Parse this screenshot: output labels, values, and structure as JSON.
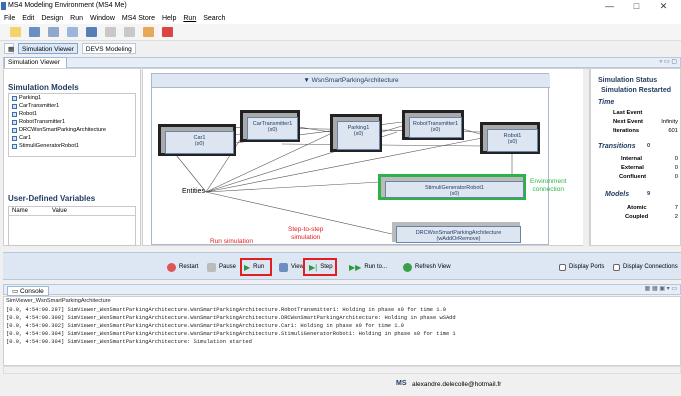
{
  "window": {
    "title": "MS4 Modeling Environment (MS4 Me)",
    "minimize": "—",
    "maximize": "□",
    "close": "✕"
  },
  "menu": [
    "File",
    "Edit",
    "Design",
    "Run",
    "Window",
    "MS4 Store",
    "Help",
    "Run",
    "Search"
  ],
  "toolbar_icons": [
    "new-icon",
    "save-icon",
    "copy-icon",
    "home-icon",
    "pen-icon",
    "nav-back-icon",
    "nav-forward-icon",
    "arrow-icon",
    "tool-icon"
  ],
  "perspective_tabs": [
    "Simulation Viewer",
    "DEVS Modeling"
  ],
  "view_tab": "Simulation Viewer",
  "sidebar": {
    "models_title": "Simulation Models",
    "models": [
      "Parking1",
      "CarTransmitter1",
      "Robot1",
      "RobotTransmitter1",
      "DRCWsnSmartParkingArchitecture",
      "Car1",
      "StimuliGeneratorRobot1"
    ],
    "vars_title": "User-Defined Variables",
    "vars_cols": [
      "Name",
      "Value"
    ]
  },
  "diagram": {
    "title": "WsnSmartParkingArchitecture",
    "blocks": {
      "car": {
        "name": "Car1",
        "phase": "(s0)"
      },
      "car_tx": {
        "name": "CarTransmitter1",
        "phase": "(s0)"
      },
      "parking": {
        "name": "Parking1",
        "phase": "(s0)"
      },
      "robot_tx": {
        "name": "RobotTransmitter1",
        "phase": "(s0)"
      },
      "robot": {
        "name": "Robot1",
        "phase": "(s0)"
      },
      "stimuli": {
        "name": "StimuliGeneratorRobot1",
        "phase": "(s0)"
      },
      "drc": {
        "name": "DRCWsnSmartParkingArchitecture",
        "phase": "(wAddOrRemove)"
      }
    },
    "annotations": {
      "entities": "Entities",
      "env1": "Environment",
      "env2": "connection",
      "run": "Run simulation",
      "step1": "Step-to-step",
      "step2": "simulation"
    }
  },
  "status": {
    "title": "Simulation Status",
    "state": "Simulation Restarted",
    "time_h": "Time",
    "last_event": "Last Event",
    "last_event_v": "",
    "next_event": "Next Event",
    "next_event_v": "Infinity",
    "iterations": "Iterations",
    "iterations_v": "601",
    "transitions_h": "Transitions",
    "transitions_v": "0",
    "internal": "Internal",
    "internal_v": "0",
    "external": "External",
    "external_v": "0",
    "confluent": "Confluent",
    "confluent_v": "0",
    "models_h": "Models",
    "models_v": "9",
    "atomic": "Atomic",
    "atomic_v": "7",
    "coupled": "Coupled",
    "coupled_v": "2"
  },
  "simbar": {
    "restart": "Restart",
    "pause": "Pause",
    "run": "Run",
    "view": "View",
    "step": "Step",
    "run_to": "Run to...",
    "refresh": "Refresh View",
    "display_ports": "Display Ports",
    "display_connections": "Display Connections"
  },
  "console": {
    "tab": "Console",
    "source": "SimViewer_WsnSmartParkingArchitecture",
    "lines": [
      "[0.0, 4:54:00.297] SimViewer_WsnSmartParkingArchitecture.WsnSmartParkingArchitecture.RobotTransmitter1: Holding in phase s0 for time 1.0",
      "[0.0, 4:54:00.300] SimViewer_WsnSmartParkingArchitecture.WsnSmartParkingArchitecture.DRCWsnSmartParkingArchitecture: Holding in phase wSAdd",
      "[0.0, 4:54:00.302] SimViewer_WsnSmartParkingArchitecture.WsnSmartParkingArchitecture.Car1: Holding in phase s0 for time 1.0",
      "[0.0, 4:54:00.304] SimViewer_WsnSmartParkingArchitecture.WsnSmartParkingArchitecture.StimuliGeneratorRobot1: Holding in phase s0 for time 1",
      "[0.0, 4:54:00.304] SimViewer_WsnSmartParkingArchitecture: Simulation started"
    ]
  },
  "statusbar": {
    "user": "alexandre.delecolle@hotmail.fr"
  },
  "colors": {
    "highlight": "#e02020",
    "env_border": "#2bb34a",
    "annotation_red": "#e02020",
    "annotation_green": "#2bb34a"
  }
}
